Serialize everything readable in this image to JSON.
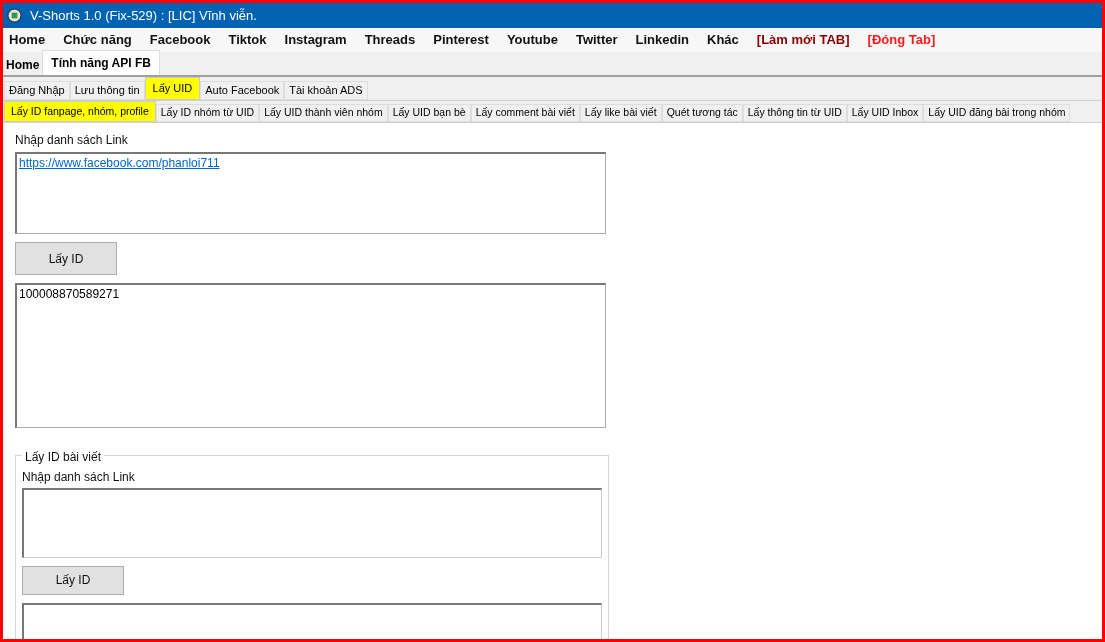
{
  "window": {
    "title": "V-Shorts 1.0 (Fix-529) : [LIC] Vĩnh viễn."
  },
  "menu": [
    {
      "label": "Home",
      "kind": "item"
    },
    {
      "label": "Chức năng",
      "kind": "item"
    },
    {
      "label": "Facebook",
      "kind": "item"
    },
    {
      "label": "Tiktok",
      "kind": "item"
    },
    {
      "label": "Instagram",
      "kind": "item"
    },
    {
      "label": "Threads",
      "kind": "item"
    },
    {
      "label": "Pinterest",
      "kind": "item"
    },
    {
      "label": "Youtube",
      "kind": "item"
    },
    {
      "label": "Twitter",
      "kind": "item"
    },
    {
      "label": "Linkedin",
      "kind": "item"
    },
    {
      "label": "Khác",
      "kind": "item"
    },
    {
      "label": "[Làm mới TAB]",
      "kind": "refresh"
    },
    {
      "label": "[Đóng Tab]",
      "kind": "close"
    }
  ],
  "page_tabs": [
    {
      "label": "Home",
      "selected": false
    },
    {
      "label": "Tính năng API FB",
      "selected": true
    }
  ],
  "feature_tabs": [
    {
      "label": "Đăng Nhập",
      "selected": false
    },
    {
      "label": "Lưu thông tin",
      "selected": false
    },
    {
      "label": "Lấy UID",
      "selected": true
    },
    {
      "label": "Auto Facebook",
      "selected": false
    },
    {
      "label": "Tài khoản ADS",
      "selected": false
    }
  ],
  "uid_tabs": [
    {
      "label": "Lấy ID fanpage, nhóm, profile",
      "selected": true
    },
    {
      "label": "Lấy ID nhóm từ UID",
      "selected": false
    },
    {
      "label": "Lấy UID thành viên nhóm",
      "selected": false
    },
    {
      "label": "Lấy UID bạn bè",
      "selected": false
    },
    {
      "label": "Lấy comment bài viết",
      "selected": false
    },
    {
      "label": "Lấy like bài viết",
      "selected": false
    },
    {
      "label": "Quét tương tác",
      "selected": false
    },
    {
      "label": "Lấy thông tin từ UID",
      "selected": false
    },
    {
      "label": "Lấy UID Inbox",
      "selected": false
    },
    {
      "label": "Lấy UID đăng bài trong nhóm",
      "selected": false
    }
  ],
  "profile_section": {
    "input_label": "Nhập danh sách Link",
    "input_value": "https://www.facebook.com/phanloi711",
    "button": "Lấy ID",
    "output_value": "100008870589271"
  },
  "post_section": {
    "title": "Lấy ID bài viết",
    "input_label": "Nhập danh sách Link",
    "button": "Lấy ID"
  }
}
